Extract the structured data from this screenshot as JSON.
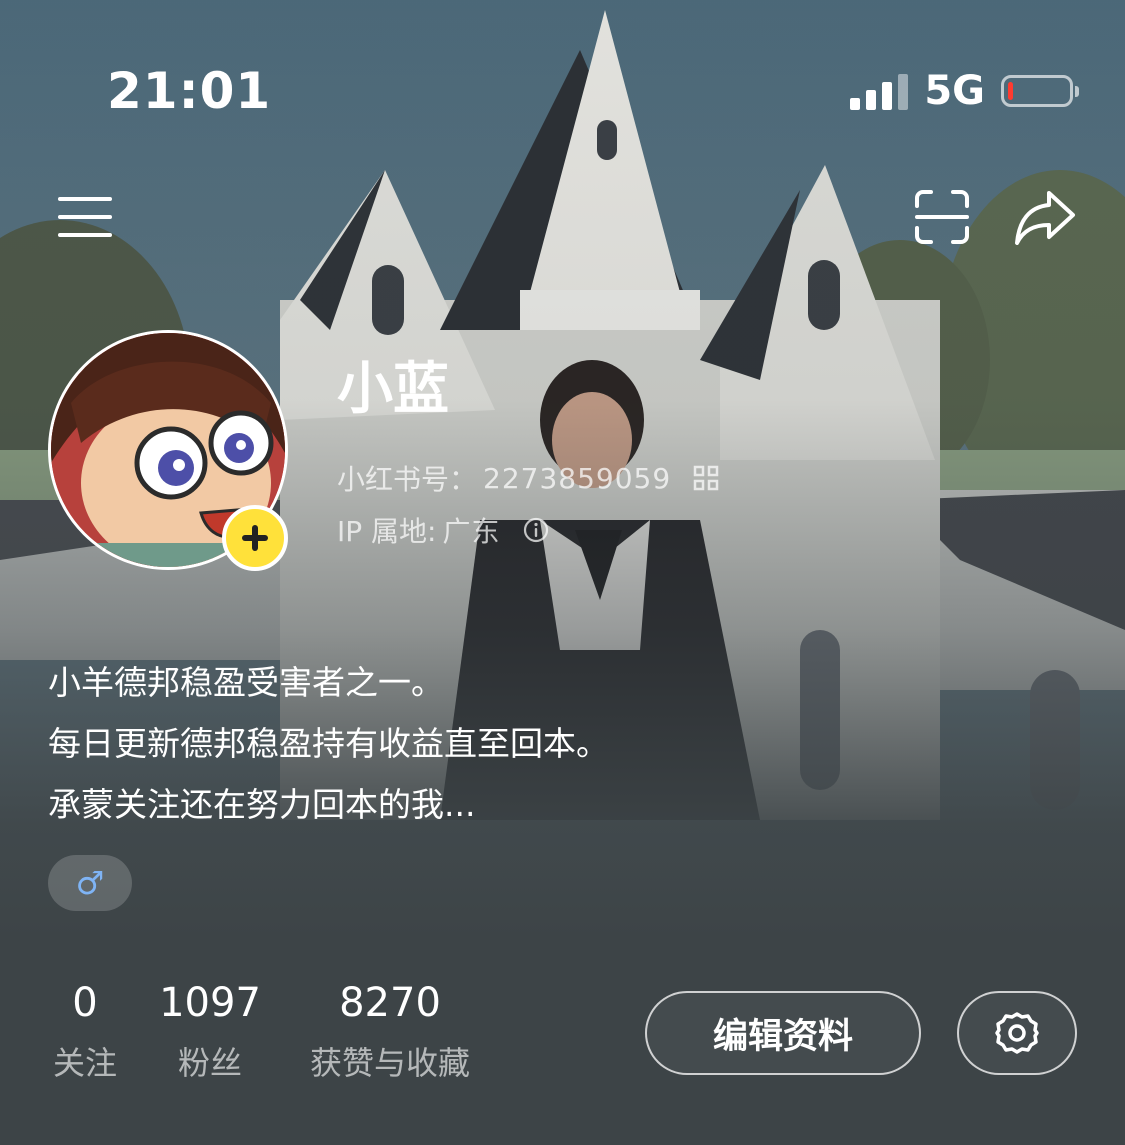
{
  "status_bar": {
    "time": "21:01",
    "network": "5G",
    "battery_level": 0.08,
    "battery_color": "#ff3b30"
  },
  "top_nav": {
    "menu_icon": "hamburger-menu-icon",
    "scan_icon": "scan-icon",
    "share_icon": "share-arrow-icon"
  },
  "profile": {
    "nickname": "小蓝",
    "id_label": "小红书号：",
    "id_value": "2273859059",
    "ip_label": "IP 属地:",
    "ip_value": "广东",
    "add_badge": "+",
    "add_badge_color": "#ffe13a",
    "bio": [
      "小羊德邦稳盈受害者之一。",
      "每日更新德邦稳盈持有收益直至回本。",
      "承蒙关注还在努力回本的我..."
    ],
    "gender_symbol": "♂",
    "gender_color": "#7fb4f5"
  },
  "stats": {
    "following": {
      "value": "0",
      "label": "关注"
    },
    "followers": {
      "value": "1097",
      "label": "粉丝"
    },
    "likes": {
      "value": "8270",
      "label": "获赞与收藏"
    }
  },
  "actions": {
    "edit_label": "编辑资料",
    "settings_icon": "gear-icon"
  }
}
